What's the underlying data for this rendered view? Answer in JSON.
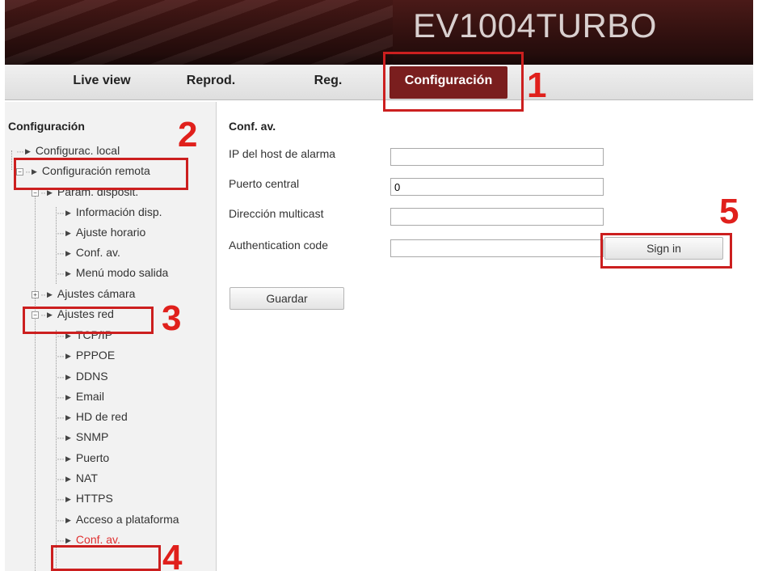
{
  "header": {
    "brand": "EV1004TURBO"
  },
  "nav": {
    "items": [
      {
        "label": "Live view"
      },
      {
        "label": "Reprod."
      },
      {
        "label": "Reg."
      },
      {
        "label": "Configuración",
        "active": true
      }
    ]
  },
  "sidebar": {
    "title": "Configuración",
    "items": [
      {
        "label": "Configurac. local"
      },
      {
        "label": "Configuración remota"
      },
      {
        "label": "Param. disposit."
      },
      {
        "label": "Información disp."
      },
      {
        "label": "Ajuste horario"
      },
      {
        "label": "Conf. av."
      },
      {
        "label": "Menú modo salida"
      },
      {
        "label": "Ajustes cámara"
      },
      {
        "label": "Ajustes red"
      },
      {
        "label": "TCP/IP"
      },
      {
        "label": "PPPOE"
      },
      {
        "label": "DDNS"
      },
      {
        "label": "Email"
      },
      {
        "label": "HD de red"
      },
      {
        "label": "SNMP"
      },
      {
        "label": "Puerto"
      },
      {
        "label": "NAT"
      },
      {
        "label": "HTTPS"
      },
      {
        "label": "Acceso a plataforma"
      },
      {
        "label": "Conf. av.",
        "selected": true
      }
    ]
  },
  "main": {
    "title": "Conf. av.",
    "fields": [
      {
        "label": "IP del host de alarma",
        "value": ""
      },
      {
        "label": "Puerto central",
        "value": "0"
      },
      {
        "label": "Dirección multicast",
        "value": ""
      },
      {
        "label": "Authentication code",
        "value": ""
      }
    ],
    "sign_in_label": "Sign in",
    "save_label": "Guardar"
  },
  "annotations": [
    "1",
    "2",
    "3",
    "4",
    "5"
  ],
  "colors": {
    "accent": "#7a1e1e",
    "annotation": "#cc1f1f",
    "selected_text": "#e03030"
  }
}
